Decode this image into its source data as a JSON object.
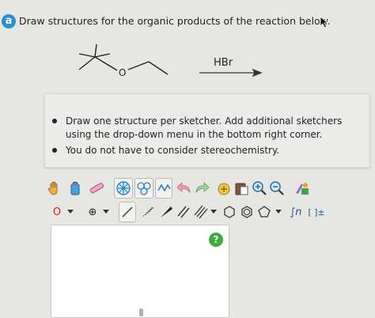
{
  "question": {
    "badge": "a",
    "prompt": "Draw structures for the organic products of the reaction below."
  },
  "reaction": {
    "reactant_atom_label": "O",
    "reagent": "HBr"
  },
  "instructions": [
    "Draw one structure per sketcher. Add additional sketchers using the drop-down menu in the bottom right corner.",
    "You do not have to consider stereochemistry."
  ],
  "toolbar_row2": {
    "atom_label": "O",
    "charge_label": "⊕",
    "sgroup_label": "∫n",
    "bracket_label": "[ ]±"
  },
  "sketcher": {
    "help_label": "?"
  },
  "colors": {
    "accent_blue": "#2c8fd0",
    "help_green": "#3dac3d",
    "atom_red": "#d42020"
  }
}
